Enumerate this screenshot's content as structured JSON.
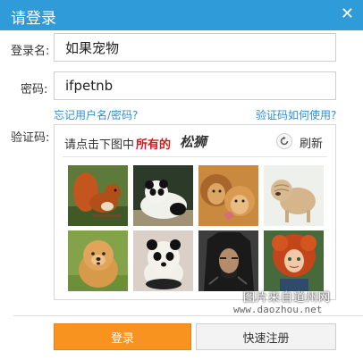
{
  "dialog": {
    "title": "请登录",
    "close_icon": "close-icon",
    "accent_color": "#2f9bd8"
  },
  "form": {
    "username_label": "登录名:",
    "username_value": "如果宠物",
    "password_label": "密码:",
    "password_value": "ifpetnb",
    "forgot_link": "忘记用户名/密码?",
    "captcha_help_link": "验证码如何使用?",
    "captcha_label": "验证码:"
  },
  "captcha": {
    "prompt_prefix": "请点击下图中",
    "prompt_emphasis": "所有的",
    "target": "松狮",
    "refresh_label": "刷新",
    "refresh_icon": "refresh-icon",
    "tiles": [
      {
        "subject": "squirrel"
      },
      {
        "subject": "panda"
      },
      {
        "subject": "lions"
      },
      {
        "subject": "shar-pei"
      },
      {
        "subject": "chow-chow"
      },
      {
        "subject": "chow-chow-panda-dyed"
      },
      {
        "subject": "wild-haired-man"
      },
      {
        "subject": "red-haired-girl"
      }
    ]
  },
  "buttons": {
    "login_label": "登录",
    "register_label": "快速注册",
    "login_color": "#f7931e"
  },
  "watermark": {
    "line1": "图片来自道州网",
    "line2": "www.daozhou.net"
  }
}
